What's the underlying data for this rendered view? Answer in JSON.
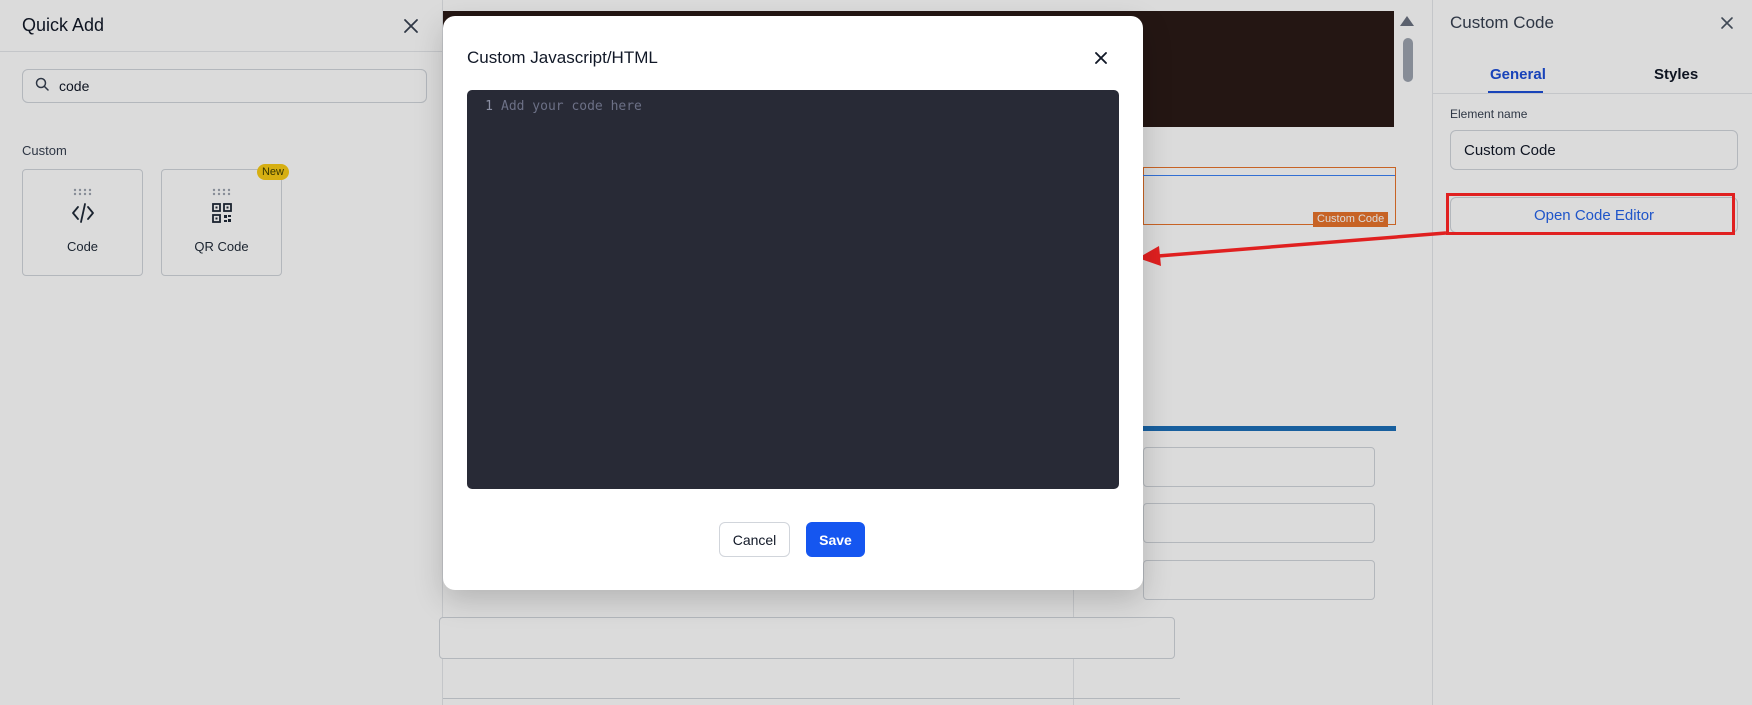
{
  "quick_add": {
    "title": "Quick Add",
    "search": {
      "value": "code",
      "icon": "search-icon"
    },
    "section_label": "Custom",
    "items": [
      {
        "label": "Code",
        "icon": "code-icon"
      },
      {
        "label": "QR Code",
        "icon": "qr-code-icon",
        "badge": "New"
      }
    ]
  },
  "canvas": {
    "selected_element_tag": "Custom Code"
  },
  "settings_panel": {
    "title": "Custom Code",
    "tabs": [
      {
        "label": "General",
        "active": true
      },
      {
        "label": "Styles",
        "active": false
      }
    ],
    "element_name_label": "Element name",
    "element_name_value": "Custom Code",
    "open_editor_label": "Open Code Editor"
  },
  "modal": {
    "title": "Custom Javascript/HTML",
    "editor": {
      "line_number": "1",
      "placeholder": "Add your code here"
    },
    "cancel_label": "Cancel",
    "save_label": "Save"
  },
  "colors": {
    "accent": "#1556f0",
    "tab_active": "#1d4ed8",
    "annotation": "#e02020",
    "selection": "#e8742c",
    "editor_bg": "#282a36",
    "badge": "#facc15"
  }
}
